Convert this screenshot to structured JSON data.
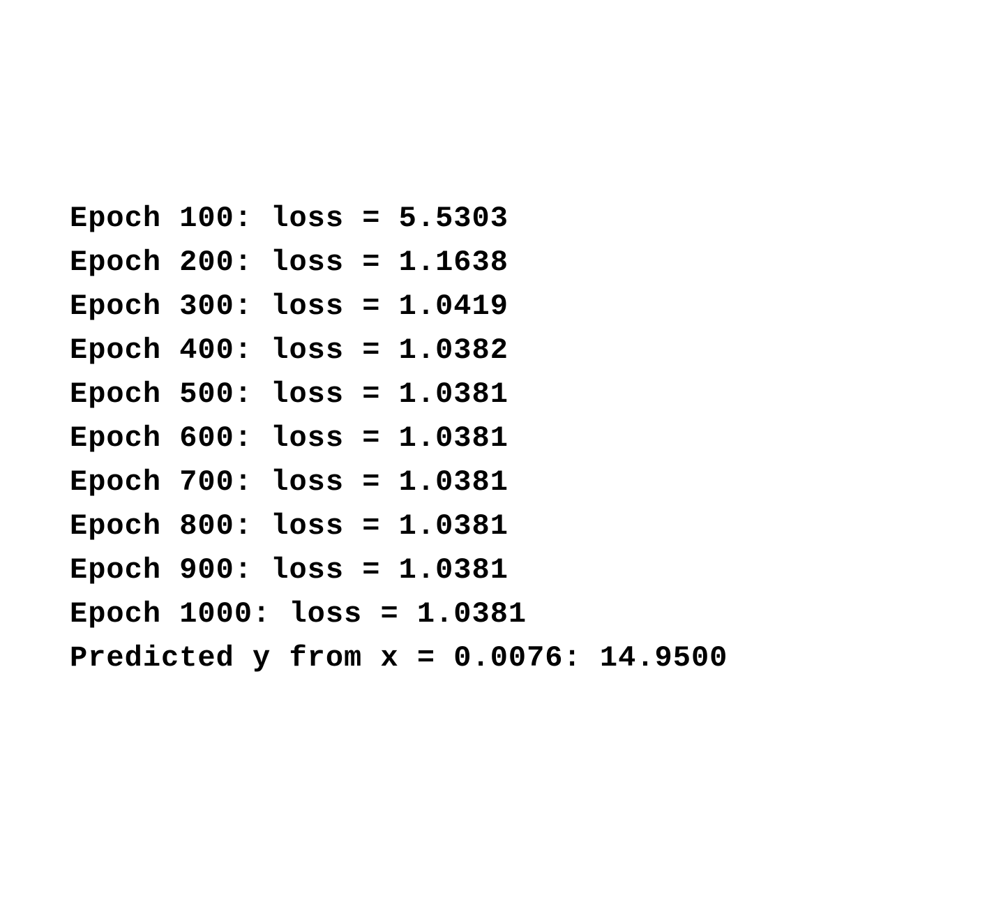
{
  "output": {
    "epochs": [
      {
        "label": "Epoch 100: loss = 5.5303"
      },
      {
        "label": "Epoch 200: loss = 1.1638"
      },
      {
        "label": "Epoch 300: loss = 1.0419"
      },
      {
        "label": "Epoch 400: loss = 1.0382"
      },
      {
        "label": "Epoch 500: loss = 1.0381"
      },
      {
        "label": "Epoch 600: loss = 1.0381"
      },
      {
        "label": "Epoch 700: loss = 1.0381"
      },
      {
        "label": "Epoch 800: loss = 1.0381"
      },
      {
        "label": "Epoch 900: loss = 1.0381"
      },
      {
        "label": "Epoch 1000: loss = 1.0381"
      }
    ],
    "prediction": "Predicted y from x = 0.0076: 14.9500"
  }
}
